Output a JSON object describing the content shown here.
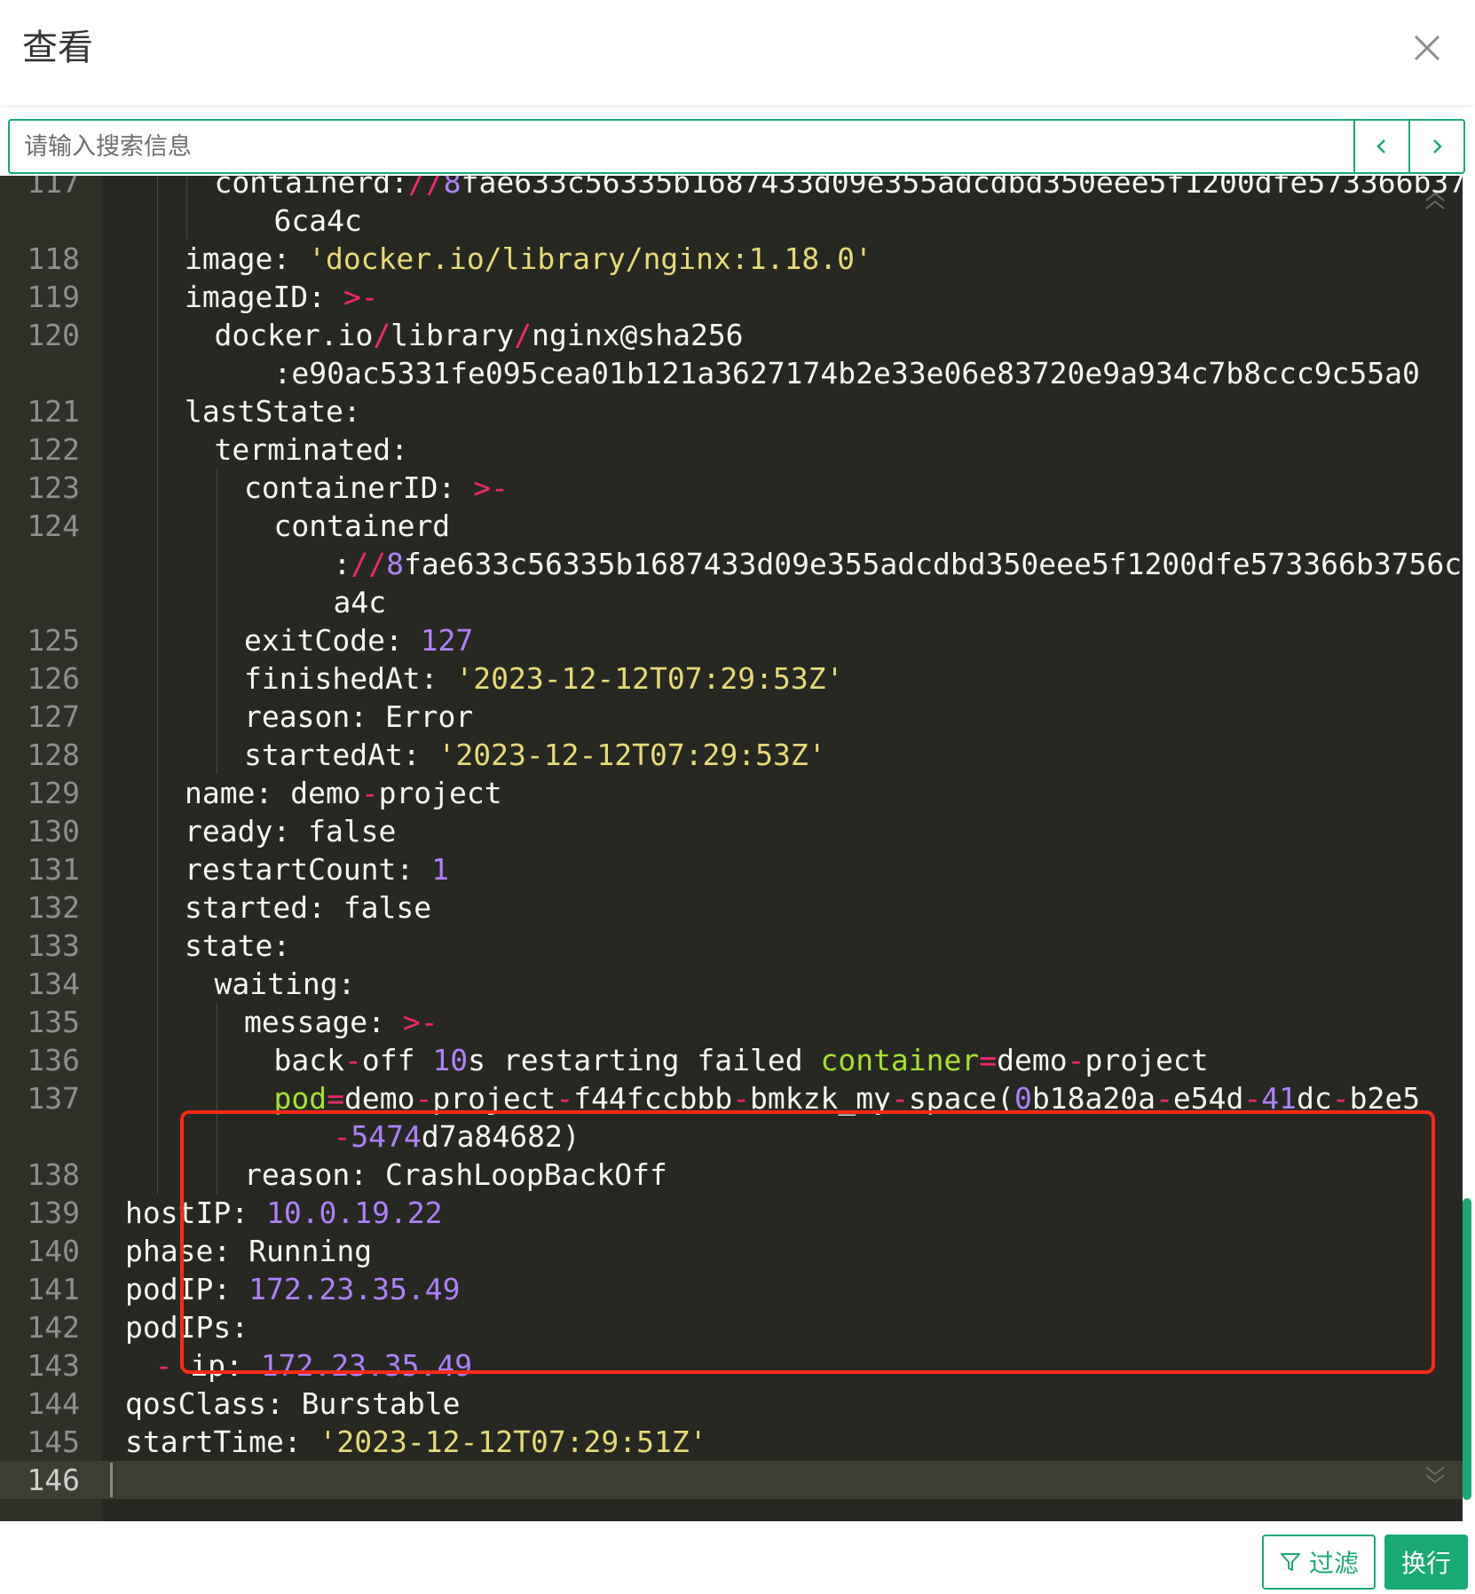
{
  "header": {
    "title": "查看"
  },
  "search": {
    "placeholder": "请输入搜索信息"
  },
  "footer": {
    "filter_label": "过滤",
    "wrap_label": "换行"
  },
  "editor": {
    "lines": [
      {
        "n": "117",
        "indent": 0,
        "guides": [],
        "tokens": []
      },
      {
        "n": "",
        "indent": 0,
        "guides": [],
        "tokens": []
      },
      {
        "n": "118",
        "indent": 0,
        "guides": [],
        "tokens": []
      },
      {
        "n": "119",
        "indent": 0,
        "guides": [],
        "tokens": []
      },
      {
        "n": "120",
        "indent": 0,
        "guides": [],
        "tokens": []
      },
      {
        "n": "",
        "indent": 0,
        "guides": [],
        "tokens": []
      },
      {
        "n": "121",
        "indent": 0,
        "guides": [],
        "tokens": []
      },
      {
        "n": "122",
        "indent": 0,
        "guides": [],
        "tokens": []
      },
      {
        "n": "123",
        "indent": 0,
        "guides": [],
        "tokens": []
      },
      {
        "n": "124",
        "indent": 0,
        "guides": [],
        "tokens": []
      },
      {
        "n": "",
        "indent": 0,
        "guides": [],
        "tokens": []
      },
      {
        "n": "",
        "indent": 0,
        "guides": [],
        "tokens": []
      },
      {
        "n": "125",
        "indent": 0,
        "guides": [],
        "tokens": []
      },
      {
        "n": "126",
        "indent": 0,
        "guides": [],
        "tokens": []
      },
      {
        "n": "127",
        "indent": 0,
        "guides": [],
        "tokens": []
      },
      {
        "n": "128",
        "indent": 0,
        "guides": [],
        "tokens": []
      },
      {
        "n": "129",
        "indent": 0,
        "guides": [],
        "tokens": []
      },
      {
        "n": "130",
        "indent": 0,
        "guides": [],
        "tokens": []
      },
      {
        "n": "131",
        "indent": 0,
        "guides": [],
        "tokens": []
      },
      {
        "n": "132",
        "indent": 0,
        "guides": [],
        "tokens": []
      },
      {
        "n": "133",
        "indent": 0,
        "guides": [],
        "tokens": []
      },
      {
        "n": "134",
        "indent": 0,
        "guides": [],
        "tokens": []
      },
      {
        "n": "135",
        "indent": 0,
        "guides": [],
        "tokens": []
      },
      {
        "n": "136",
        "indent": 0,
        "guides": [],
        "tokens": []
      },
      {
        "n": "137",
        "indent": 0,
        "guides": [],
        "tokens": []
      },
      {
        "n": "",
        "indent": 0,
        "guides": [],
        "tokens": []
      },
      {
        "n": "138",
        "indent": 0,
        "guides": [],
        "tokens": []
      },
      {
        "n": "139",
        "indent": 0,
        "guides": [],
        "tokens": []
      },
      {
        "n": "140",
        "indent": 0,
        "guides": [],
        "tokens": []
      },
      {
        "n": "141",
        "indent": 0,
        "guides": [],
        "tokens": []
      },
      {
        "n": "142",
        "indent": 0,
        "guides": [],
        "tokens": []
      },
      {
        "n": "143",
        "indent": 0,
        "guides": [],
        "tokens": []
      },
      {
        "n": "144",
        "indent": 0,
        "guides": [],
        "tokens": []
      },
      {
        "n": "145",
        "indent": 0,
        "guides": [],
        "tokens": []
      },
      {
        "n": "146",
        "indent": 0,
        "guides": [],
        "tokens": [],
        "active": true
      }
    ]
  }
}
